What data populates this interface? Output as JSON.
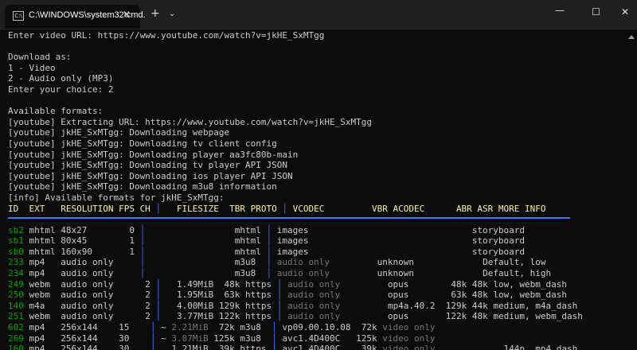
{
  "window": {
    "tab_title": "C:\\WINDOWS\\system32\\cmd.",
    "tab_icon_text": "C:\\",
    "tab_close": "✕",
    "new_tab": "+",
    "dropdown": "⌄",
    "minimize": "—",
    "maximize": "☐",
    "close": "✕"
  },
  "terminal": {
    "lines": [
      [
        {
          "t": "Enter video URL: https://www.youtube.com/watch?v=jkHE_SxMTgg",
          "c": "w"
        }
      ],
      [
        {
          "t": "",
          "c": "w"
        }
      ],
      [
        {
          "t": "Download as:",
          "c": "w"
        }
      ],
      [
        {
          "t": "1 - Video",
          "c": "w"
        }
      ],
      [
        {
          "t": "2 - Audio only (MP3)",
          "c": "w"
        }
      ],
      [
        {
          "t": "Enter your choice: 2",
          "c": "w"
        }
      ],
      [
        {
          "t": "",
          "c": "w"
        }
      ],
      [
        {
          "t": "Available formats:",
          "c": "w"
        }
      ],
      [
        {
          "t": "[youtube] Extracting URL: https://www.youtube.com/watch?v=jkHE_SxMTgg",
          "c": "w"
        }
      ],
      [
        {
          "t": "[youtube] jkHE_SxMTgg: Downloading webpage",
          "c": "w"
        }
      ],
      [
        {
          "t": "[youtube] jkHE_SxMTgg: Downloading tv client config",
          "c": "w"
        }
      ],
      [
        {
          "t": "[youtube] jkHE_SxMTgg: Downloading player aa3fc80b-main",
          "c": "w"
        }
      ],
      [
        {
          "t": "[youtube] jkHE_SxMTgg: Downloading tv player API JSON",
          "c": "w"
        }
      ],
      [
        {
          "t": "[youtube] jkHE_SxMTgg: Downloading ios player API JSON",
          "c": "w"
        }
      ],
      [
        {
          "t": "[youtube] jkHE_SxMTgg: Downloading m3u8 information",
          "c": "w"
        }
      ],
      [
        {
          "t": "[info] Available formats for jkHE_SxMTgg:",
          "c": "w"
        }
      ],
      [
        {
          "t": "ID  EXT   RESOLUTION FPS CH ",
          "c": "y"
        },
        {
          "t": "│",
          "c": "b"
        },
        {
          "t": "   FILESIZE  TBR PROTO ",
          "c": "y"
        },
        {
          "t": "│",
          "c": "b"
        },
        {
          "t": " VCODEC         VBR ACODEC      ABR ASR MORE INFO",
          "c": "y"
        }
      ],
      [
        {
          "t": "",
          "c": "w"
        }
      ],
      [
        {
          "t": "sb2",
          "c": "g"
        },
        {
          "t": " mhtml 48x27        0 ",
          "c": "w"
        },
        {
          "t": "│",
          "c": "b"
        },
        {
          "t": "                 mhtml ",
          "c": "w"
        },
        {
          "t": "│",
          "c": "b"
        },
        {
          "t": " images                               storyboard",
          "c": "w"
        }
      ],
      [
        {
          "t": "sb1",
          "c": "g"
        },
        {
          "t": " mhtml 80x45        1 ",
          "c": "w"
        },
        {
          "t": "│",
          "c": "b"
        },
        {
          "t": "                 mhtml ",
          "c": "w"
        },
        {
          "t": "│",
          "c": "b"
        },
        {
          "t": " images                               storyboard",
          "c": "w"
        }
      ],
      [
        {
          "t": "sb0",
          "c": "g"
        },
        {
          "t": " mhtml 160x90       1 ",
          "c": "w"
        },
        {
          "t": "│",
          "c": "b"
        },
        {
          "t": "                 mhtml ",
          "c": "w"
        },
        {
          "t": "│",
          "c": "b"
        },
        {
          "t": " images                               storyboard",
          "c": "w"
        }
      ],
      [
        {
          "t": "233",
          "c": "g"
        },
        {
          "t": " mp4   audio only     ",
          "c": "w"
        },
        {
          "t": "│",
          "c": "b"
        },
        {
          "t": "                 m3u8  ",
          "c": "w"
        },
        {
          "t": "│",
          "c": "b"
        },
        {
          "t": " ",
          "c": "w"
        },
        {
          "t": "audio only",
          "c": "d"
        },
        {
          "t": "         unknown             Default, low",
          "c": "w"
        }
      ],
      [
        {
          "t": "234",
          "c": "g"
        },
        {
          "t": " mp4   audio only     ",
          "c": "w"
        },
        {
          "t": "│",
          "c": "b"
        },
        {
          "t": "                 m3u8  ",
          "c": "w"
        },
        {
          "t": "│",
          "c": "b"
        },
        {
          "t": " ",
          "c": "w"
        },
        {
          "t": "audio only",
          "c": "d"
        },
        {
          "t": "         unknown             Default, high",
          "c": "w"
        }
      ],
      [
        {
          "t": "249",
          "c": "g"
        },
        {
          "t": " webm  audio only      2 ",
          "c": "w"
        },
        {
          "t": "│",
          "c": "b"
        },
        {
          "t": "   1.49MiB  48k https ",
          "c": "w"
        },
        {
          "t": "│",
          "c": "b"
        },
        {
          "t": " ",
          "c": "w"
        },
        {
          "t": "audio only",
          "c": "d"
        },
        {
          "t": "         opus        48k 48k low, webm_dash",
          "c": "w"
        }
      ],
      [
        {
          "t": "250",
          "c": "g"
        },
        {
          "t": " webm  audio only      2 ",
          "c": "w"
        },
        {
          "t": "│",
          "c": "b"
        },
        {
          "t": "   1.95MiB  63k https ",
          "c": "w"
        },
        {
          "t": "│",
          "c": "b"
        },
        {
          "t": " ",
          "c": "w"
        },
        {
          "t": "audio only",
          "c": "d"
        },
        {
          "t": "         opus        63k 48k low, webm_dash",
          "c": "w"
        }
      ],
      [
        {
          "t": "140",
          "c": "g"
        },
        {
          "t": " m4a   audio only      2 ",
          "c": "w"
        },
        {
          "t": "│",
          "c": "b"
        },
        {
          "t": "   4.00MiB 129k https ",
          "c": "w"
        },
        {
          "t": "│",
          "c": "b"
        },
        {
          "t": " ",
          "c": "w"
        },
        {
          "t": "audio only",
          "c": "d"
        },
        {
          "t": "         mp4a.40.2  129k 44k medium, m4a_dash",
          "c": "w"
        }
      ],
      [
        {
          "t": "251",
          "c": "g"
        },
        {
          "t": " webm  audio only      2 ",
          "c": "w"
        },
        {
          "t": "│",
          "c": "b"
        },
        {
          "t": "   3.77MiB 122k https ",
          "c": "w"
        },
        {
          "t": "│",
          "c": "b"
        },
        {
          "t": " ",
          "c": "w"
        },
        {
          "t": "audio only",
          "c": "d"
        },
        {
          "t": "         opus       122k 48k medium, webm_dash",
          "c": "w"
        }
      ],
      [
        {
          "t": "602",
          "c": "g"
        },
        {
          "t": " mp4   256x144    15    ",
          "c": "w"
        },
        {
          "t": "│",
          "c": "b"
        },
        {
          "t": " ~ ",
          "c": "w"
        },
        {
          "t": "2.21MiB",
          "c": "d"
        },
        {
          "t": "  72k m3u8  ",
          "c": "w"
        },
        {
          "t": "│",
          "c": "b"
        },
        {
          "t": " vp09.00.10.08  72k ",
          "c": "w"
        },
        {
          "t": "video only",
          "c": "d"
        }
      ],
      [
        {
          "t": "269",
          "c": "g"
        },
        {
          "t": " mp4   256x144    30    ",
          "c": "w"
        },
        {
          "t": "│",
          "c": "b"
        },
        {
          "t": " ~ ",
          "c": "w"
        },
        {
          "t": "3.87MiB",
          "c": "d"
        },
        {
          "t": " 125k m3u8  ",
          "c": "w"
        },
        {
          "t": "│",
          "c": "b"
        },
        {
          "t": " avc1.4D400C   125k ",
          "c": "w"
        },
        {
          "t": "video only",
          "c": "d"
        }
      ],
      [
        {
          "t": "160",
          "c": "g"
        },
        {
          "t": " mp4   256x144    30    ",
          "c": "w"
        },
        {
          "t": "│",
          "c": "b"
        },
        {
          "t": "   1.21MiB  39k https ",
          "c": "w"
        },
        {
          "t": "│",
          "c": "b"
        },
        {
          "t": " avc1.4D400C    39k ",
          "c": "w"
        },
        {
          "t": "video only",
          "c": "d"
        },
        {
          "t": "             144p, mp4_dash",
          "c": "w"
        }
      ]
    ]
  }
}
